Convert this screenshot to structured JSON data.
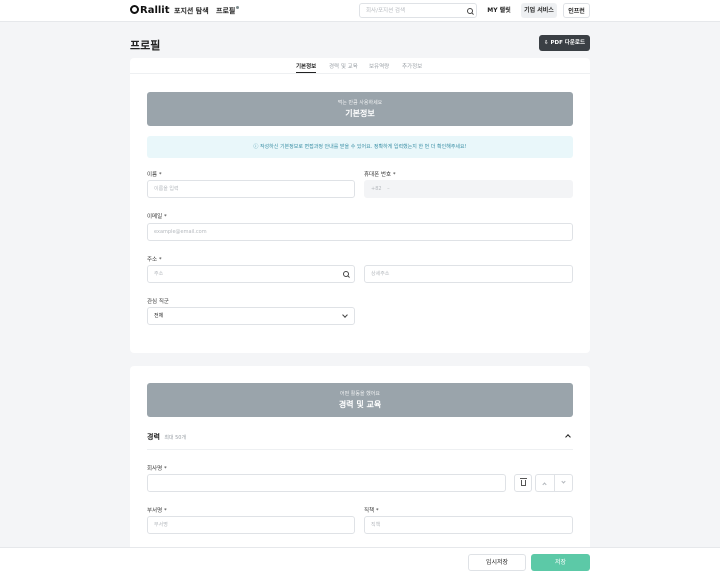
{
  "header": {
    "logo": "Rallit",
    "nav": [
      "포지션 탐색",
      "프로필"
    ],
    "search_placeholder": "회사/포지션 검색",
    "buttons": [
      "MY 랠릿",
      "기업 서비스",
      "인프런"
    ]
  },
  "page": {
    "title": "프로필",
    "pdf_button": "PDF 다운로드"
  },
  "tabs": [
    "기본정보",
    "경력 및 교육",
    "보유역량",
    "추가정보"
  ],
  "basic": {
    "banner_sub": "먹는 만큼 사용하세요",
    "banner_title": "기본정보",
    "notice": "작성하신 기본정보로 면접과정 안내를 받을 수 있어요. 정확하게 입력했는지 한 번 더 확인해주세요!",
    "name_label": "이름",
    "name_placeholder": "이름을 입력",
    "phone_label": "휴대폰 번호",
    "phone_prefix": "+82",
    "phone_value": "",
    "email_label": "이메일",
    "email_placeholder": "example@email.com",
    "address_label": "주소",
    "address_placeholder": "주소",
    "address_detail_placeholder": "상세주소",
    "job_label": "관심 직군",
    "job_value": "전체",
    "required_mark": "*"
  },
  "career": {
    "banner_sub": "어떤 활동을 했어요",
    "banner_title": "경력 및 교육",
    "section_title": "경력",
    "section_hint": "최대 50개",
    "company_label": "회사명",
    "company_value": "",
    "department_label": "부서명",
    "department_placeholder": "부서명",
    "position_label": "직책",
    "position_placeholder": "직책"
  },
  "footer": {
    "save_temp": "임시저장",
    "save": "저장"
  },
  "colors": {
    "banner": "#9aa4ab",
    "notice_bg": "#e9f7fa",
    "save_button": "#5cc9a7",
    "pdf_button": "#3a3f44"
  }
}
